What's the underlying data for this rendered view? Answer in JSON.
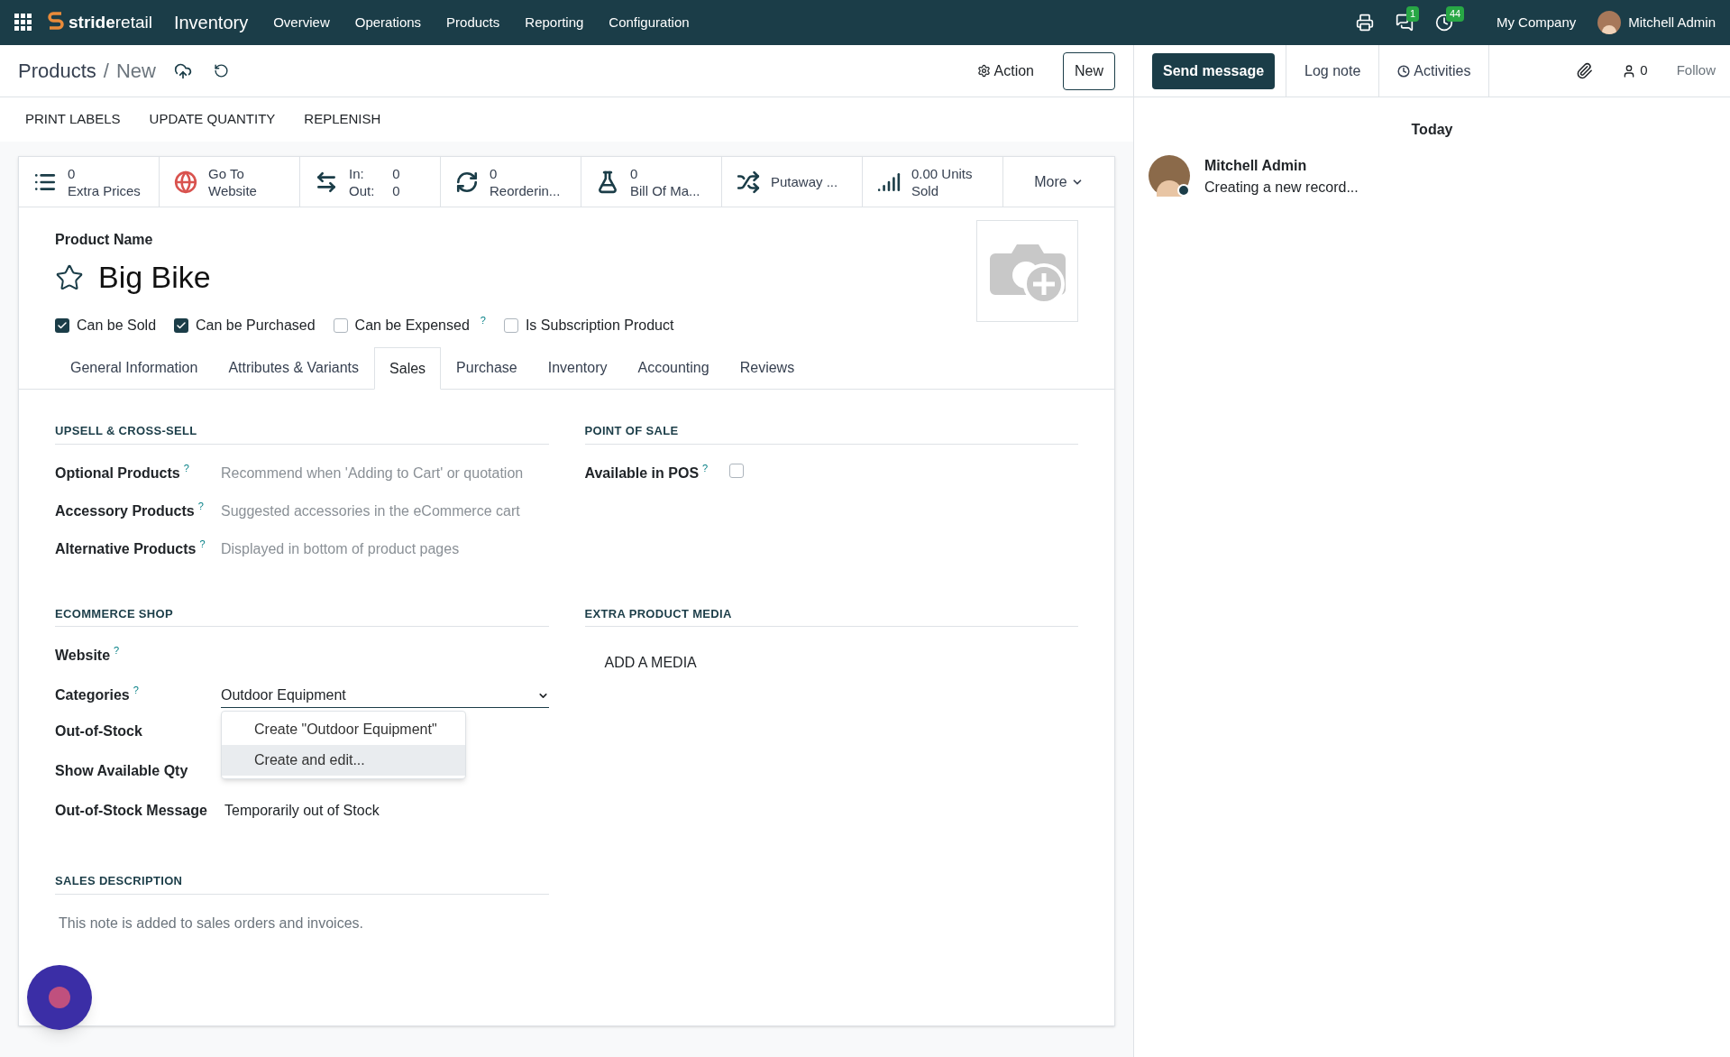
{
  "navbar": {
    "logo": {
      "bold": "stride",
      "light": "retail"
    },
    "app": "Inventory",
    "menus": [
      "Overview",
      "Operations",
      "Products",
      "Reporting",
      "Configuration"
    ],
    "messages_badge": "1",
    "activities_badge": "44",
    "company": "My Company",
    "user": "Mitchell Admin"
  },
  "breadcrumb": {
    "parent": "Products",
    "separator": "/",
    "current": "New"
  },
  "actions": {
    "action": "Action",
    "new": "New"
  },
  "header_buttons": [
    "PRINT LABELS",
    "UPDATE QUANTITY",
    "REPLENISH"
  ],
  "smart_buttons": [
    {
      "kind": "stat",
      "value": "0",
      "label": "Extra Prices"
    },
    {
      "kind": "stat",
      "value": "Go To",
      "label": "Website"
    },
    {
      "kind": "inout",
      "in_label": "In:",
      "in_value": "0",
      "out_label": "Out:",
      "out_value": "0"
    },
    {
      "kind": "stat",
      "value": "0",
      "label": "Reorderin..."
    },
    {
      "kind": "stat",
      "value": "0",
      "label": "Bill Of Ma..."
    },
    {
      "kind": "single",
      "label": "Putaway ..."
    },
    {
      "kind": "stat",
      "value": "0.00 Units",
      "label": "Sold"
    },
    {
      "kind": "more",
      "label": "More"
    }
  ],
  "product": {
    "name_label": "Product Name",
    "name": "Big Bike",
    "favorite": false
  },
  "options": [
    {
      "label": "Can be Sold",
      "checked": true
    },
    {
      "label": "Can be Purchased",
      "checked": true
    },
    {
      "label": "Can be Expensed",
      "checked": false,
      "help": "?"
    },
    {
      "label": "Is Subscription Product",
      "checked": false
    }
  ],
  "tabs": [
    {
      "label": "General Information",
      "selected": false
    },
    {
      "label": "Attributes & Variants",
      "selected": false
    },
    {
      "label": "Sales",
      "selected": true
    },
    {
      "label": "Purchase",
      "selected": false
    },
    {
      "label": "Inventory",
      "selected": false
    },
    {
      "label": "Accounting",
      "selected": false
    },
    {
      "label": "Reviews",
      "selected": false
    }
  ],
  "upsell": {
    "title": "UPSELL & CROSS-SELL",
    "fields": [
      {
        "label": "Optional Products",
        "help": "?",
        "placeholder": "Recommend when 'Adding to Cart' or quotation"
      },
      {
        "label": "Accessory Products",
        "help": "?",
        "placeholder": "Suggested accessories in the eCommerce cart"
      },
      {
        "label": "Alternative Products",
        "help": "?",
        "placeholder": "Displayed in bottom of product pages"
      }
    ]
  },
  "point_of_sale": {
    "title": "POINT OF SALE",
    "label": "Available in POS",
    "help": "?",
    "checked": false
  },
  "ecommerce": {
    "title": "ECOMMERCE SHOP",
    "website": {
      "label": "Website",
      "help": "?"
    },
    "categories": {
      "label": "Categories",
      "help": "?",
      "value": "Outdoor Equipment"
    },
    "autocomplete": [
      {
        "label": "Create \"Outdoor Equipment\"",
        "selected": false
      },
      {
        "label": "Create and edit...",
        "selected": true
      }
    ],
    "out_of_stock": {
      "label": "Out-of-Stock"
    },
    "show_qty": {
      "label": "Show Available Qty"
    },
    "message": {
      "label": "Out-of-Stock Message",
      "value": "Temporarily out of Stock"
    }
  },
  "media": {
    "title": "EXTRA PRODUCT MEDIA",
    "add": "ADD A MEDIA"
  },
  "sales_description": {
    "title": "SALES DESCRIPTION",
    "placeholder": "This note is added to sales orders and invoices."
  },
  "chatter": {
    "tabs": [
      {
        "label": "Send message",
        "selected": true
      },
      {
        "label": "Log note",
        "selected": false
      },
      {
        "label": "Activities",
        "selected": false
      }
    ],
    "followers": "0",
    "follow": "Follow",
    "day": "Today",
    "messages": [
      {
        "author": "Mitchell Admin",
        "body": "Creating a new record..."
      }
    ]
  }
}
